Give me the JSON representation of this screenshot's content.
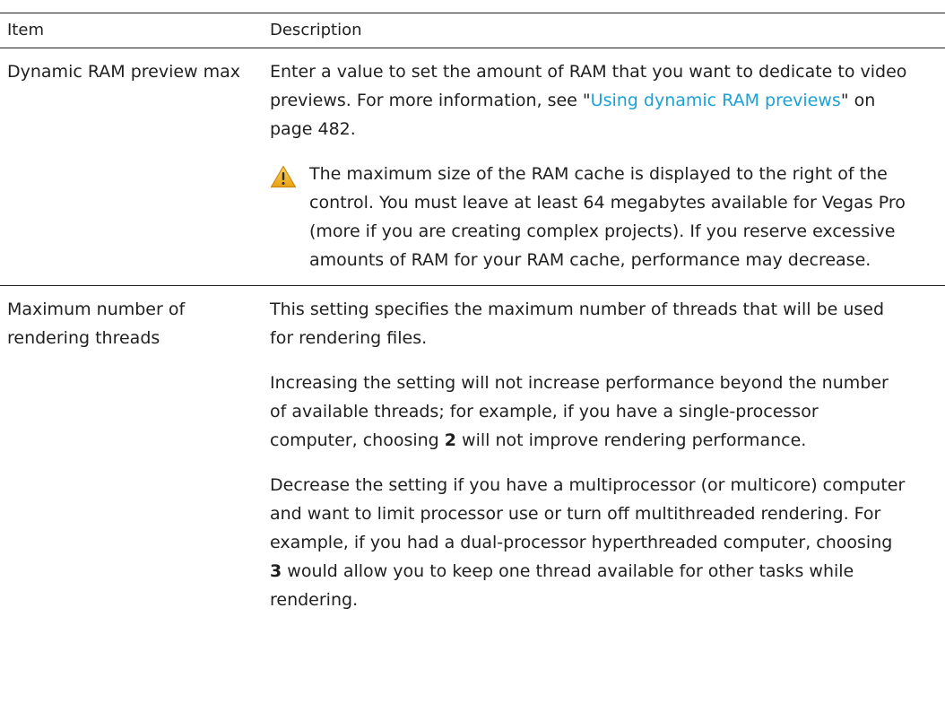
{
  "table": {
    "headers": {
      "item": "Item",
      "description": "Description"
    },
    "rows": [
      {
        "item": "Dynamic RAM preview max",
        "para1_pre": "Enter a value to set the amount of RAM that you want to dedicate to video previews. For more information, see \"",
        "para1_link": "Using dynamic RAM previews",
        "para1_post": "\" on page 482.",
        "warning_icon": "warning-triangle-icon",
        "warning_text": "The maximum size of the RAM cache is displayed to the right of the control. You must leave at least 64 megabytes available for Vegas Pro (more if you are creating complex projects). If you reserve excessive amounts of RAM for your RAM cache, performance may decrease."
      },
      {
        "item": "Maximum number of rendering threads",
        "para1": "This setting specifies the maximum number of threads that will be used for rendering files.",
        "para2_pre": "Increasing the setting will not increase performance beyond the number of available threads; for example, if you have a single-processor computer, choosing ",
        "para2_bold": "2",
        "para2_post": " will not improve rendering performance.",
        "para3_pre": "Decrease the setting if you have a multiprocessor (or multicore) computer and want to limit processor use or turn off multithreaded rendering. For example, if you had a dual-processor hyperthreaded computer, choosing ",
        "para3_bold": "3",
        "para3_post": " would allow you to keep one thread available for other tasks while rendering."
      }
    ]
  },
  "colors": {
    "link": "#1ba1d6",
    "warning_fill": "#f2b521",
    "rule": "#222222"
  }
}
